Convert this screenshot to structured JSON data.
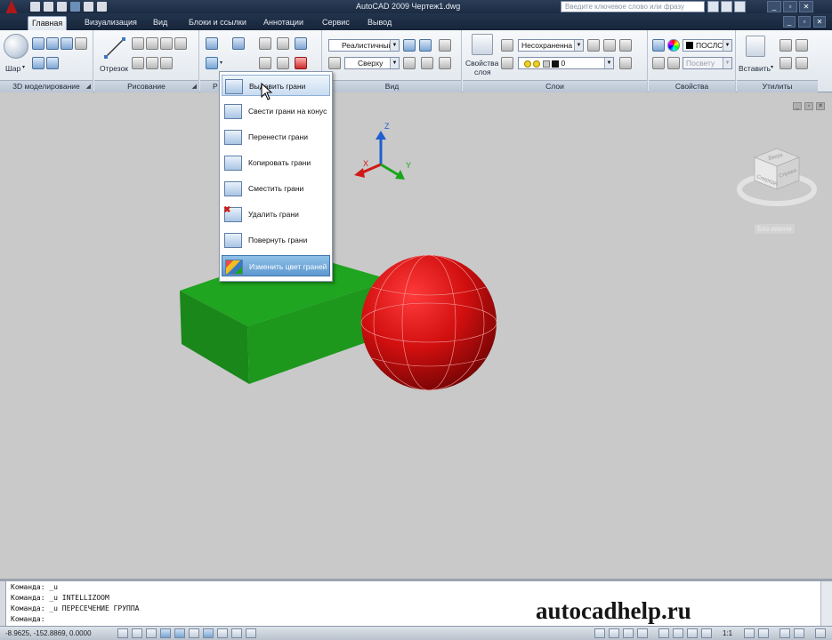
{
  "app": {
    "title": "AutoCAD 2009 Чертеж1.dwg",
    "search_placeholder": "Введите ключевое слово или фразу"
  },
  "tabs": [
    {
      "label": "Главная",
      "active": true
    },
    {
      "label": "Визуализация"
    },
    {
      "label": "Вид"
    },
    {
      "label": "Блоки и ссылки"
    },
    {
      "label": "Аннотации"
    },
    {
      "label": "Сервис"
    },
    {
      "label": "Вывод"
    }
  ],
  "ribbon": {
    "panels": {
      "modeling": "3D моделирование",
      "draw": "Рисование",
      "edit_abbrev": "Р",
      "view": "Вид",
      "layers": "Слои",
      "properties": "Свойства",
      "utilities": "Утилиты"
    },
    "sphere_label": "Шар",
    "line_label": "Отрезок",
    "visual_style": "Реалистичный",
    "view_select": "Сверху",
    "layer_props_label_1": "Свойства",
    "layer_props_label_2": "слоя",
    "layer_state": "Несохраненна",
    "layer_current": "0",
    "color_value": "ПОСЛС",
    "linetype_value": "Посвету",
    "insert_label": "Вставить"
  },
  "menu": {
    "items": [
      {
        "label": "Выдавить грани",
        "state": "hover",
        "icon": "extrude-face-icon"
      },
      {
        "label": "Свести грани на конус",
        "icon": "taper-face-icon"
      },
      {
        "label": "Перенести грани",
        "icon": "move-face-icon"
      },
      {
        "label": "Копировать грани",
        "icon": "copy-face-icon"
      },
      {
        "label": "Сместить грани",
        "icon": "offset-face-icon"
      },
      {
        "label": "Удалить грани",
        "icon": "delete-face-icon"
      },
      {
        "label": "Повернуть грани",
        "icon": "rotate-face-icon"
      },
      {
        "label": "Изменить цвет граней",
        "state": "selected",
        "icon": "color-face-icon"
      }
    ]
  },
  "viewport": {
    "viewcube_top": "Вверх",
    "viewcube_front": "Спереди",
    "viewcube_right": "Справа",
    "wcs_label": "Без имени",
    "ucs_x": "X",
    "ucs_y": "Y",
    "ucs_z": "Z",
    "box_color": "#1fa51f",
    "sphere_color": "#d01010"
  },
  "command_line": {
    "lines": [
      "Команда: _u",
      "Команда: _u INTELLIZOOM",
      "Команда: _u ПЕРЕСЕЧЕНИЕ ГРУППА",
      "Команда:"
    ]
  },
  "status_bar": {
    "coordinates": "-8.9625, -152.8869, 0.0000",
    "scale": "1:1"
  },
  "watermark": "autocadhelp.ru"
}
